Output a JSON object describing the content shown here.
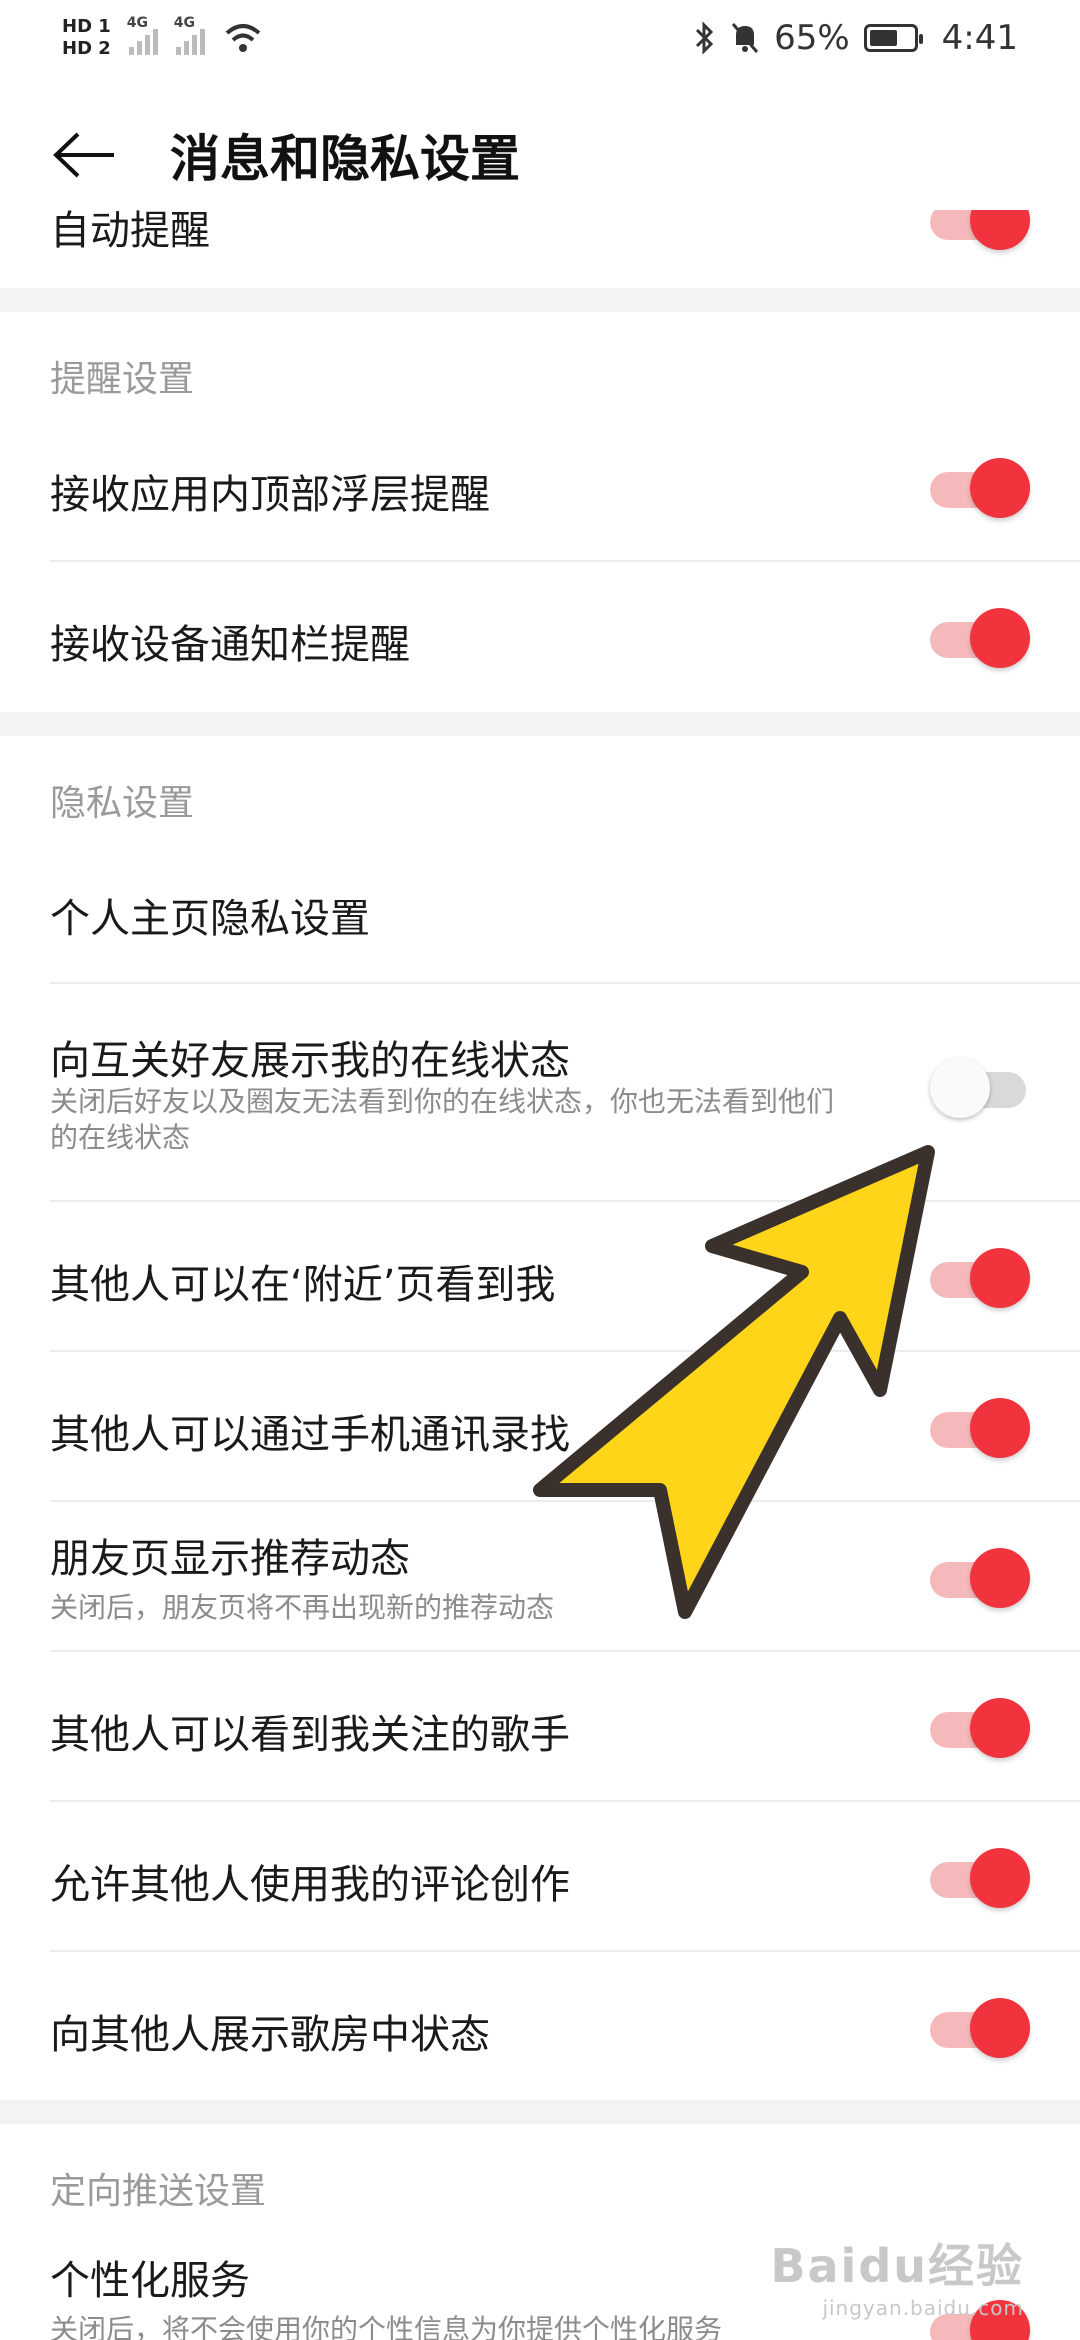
{
  "status": {
    "sim1": "HD 1",
    "sim2": "HD 2",
    "net1": "4G",
    "net2": "4G",
    "battery": "65%",
    "battery_level": 0.65,
    "time": "4:41"
  },
  "header": {
    "title": "消息和隐私设置"
  },
  "top_partial": {
    "label": "自动提醒"
  },
  "reminder": {
    "title": "提醒设置",
    "items": [
      {
        "label": "接收应用内顶部浮层提醒",
        "on": true
      },
      {
        "label": "接收设备通知栏提醒",
        "on": true
      }
    ]
  },
  "privacy": {
    "title": "隐私设置",
    "items": [
      {
        "label": "个人主页隐私设置"
      },
      {
        "label": "向互关好友展示我的在线状态",
        "sub": "关闭后好友以及圈友无法看到你的在线状态，你也无法看到他们的在线状态",
        "on": false
      },
      {
        "label": "其他人可以在‘附近’页看到我",
        "on": true
      },
      {
        "label": "其他人可以通过手机通讯录找",
        "on": true
      },
      {
        "label": "朋友页显示推荐动态",
        "sub": "关闭后，朋友页将不再出现新的推荐动态",
        "on": true
      },
      {
        "label": "其他人可以看到我关注的歌手",
        "on": true
      },
      {
        "label": "允许其他人使用我的评论创作",
        "on": true
      },
      {
        "label": "向其他人展示歌房中状态",
        "on": true
      }
    ]
  },
  "targeted": {
    "title": "定向推送设置",
    "items": [
      {
        "label": "个性化服务",
        "sub": "关闭后，将不会使用你的个性信息为你提供个性化服务",
        "on": true
      }
    ]
  },
  "watermark": {
    "main": "Baidu经验",
    "sub": "jingyan.baidu.com"
  },
  "colors": {
    "accent": "#f0333d",
    "accent_track": "#f6b9bb",
    "annotation_arrow": "#ffd519"
  }
}
